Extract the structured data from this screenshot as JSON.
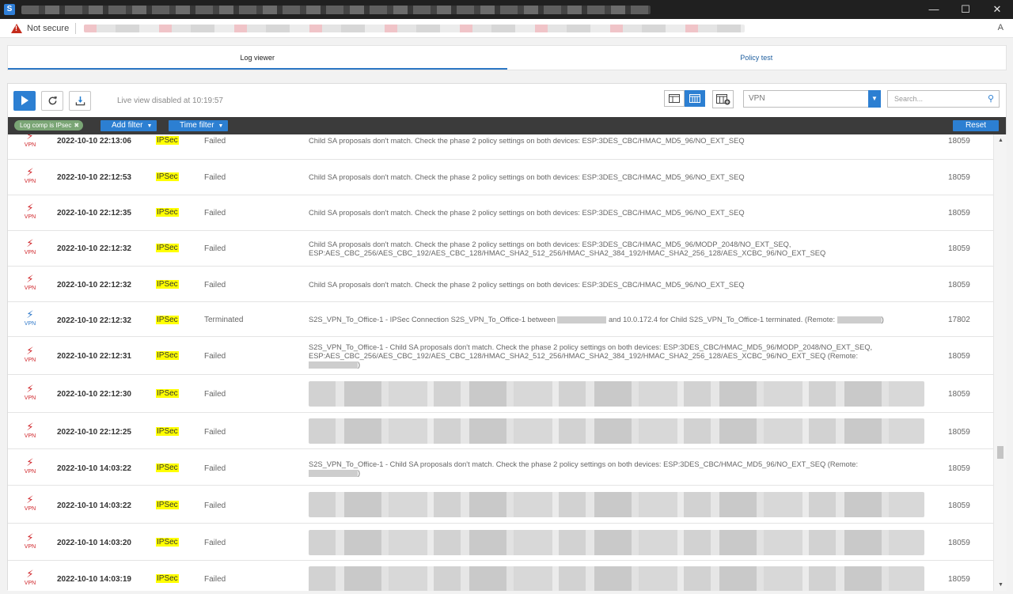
{
  "window": {
    "app_icon_letter": "S",
    "minimize": "—",
    "maximize": "☐",
    "close": "✕"
  },
  "address": {
    "security_label": "Not secure",
    "reader_icon": "A"
  },
  "tabs": [
    {
      "label": "Log viewer"
    },
    {
      "label": "Policy test"
    }
  ],
  "toolbar": {
    "live_status": "Live view disabled at 10:19:57",
    "play_icon": "play-icon",
    "refresh_icon": "refresh-icon",
    "download_icon": "download-icon",
    "log_type_value": "VPN",
    "search_placeholder": "Search..."
  },
  "filters": {
    "chip_label": "Log comp is IPsec",
    "chip_remove": "✖",
    "add_filter": "Add filter",
    "time_filter": "Time filter",
    "reset": "Reset"
  },
  "rows": [
    {
      "type_label": "VPN",
      "time": "2022-10-10 22:13:06",
      "component": "IPSec",
      "status": "Failed",
      "message": "Child SA proposals don't match. Check the phase 2 policy settings on both devices: ESP:3DES_CBC/HMAC_MD5_96/NO_EXT_SEQ",
      "id": "18059"
    },
    {
      "type_label": "VPN",
      "time": "2022-10-10 22:12:53",
      "component": "IPSec",
      "status": "Failed",
      "message": "Child SA proposals don't match. Check the phase 2 policy settings on both devices: ESP:3DES_CBC/HMAC_MD5_96/NO_EXT_SEQ",
      "id": "18059"
    },
    {
      "type_label": "VPN",
      "time": "2022-10-10 22:12:35",
      "component": "IPSec",
      "status": "Failed",
      "message": "Child SA proposals don't match. Check the phase 2 policy settings on both devices: ESP:3DES_CBC/HMAC_MD5_96/NO_EXT_SEQ",
      "id": "18059"
    },
    {
      "type_label": "VPN",
      "time": "2022-10-10 22:12:32",
      "component": "IPSec",
      "status": "Failed",
      "message_line1": "Child SA proposals don't match. Check the phase 2 policy settings on both devices: ESP:3DES_CBC/HMAC_MD5_96/MODP_2048/NO_EXT_SEQ,",
      "message_line2": "ESP:AES_CBC_256/AES_CBC_192/AES_CBC_128/HMAC_SHA2_512_256/HMAC_SHA2_384_192/HMAC_SHA2_256_128/AES_XCBC_96/NO_EXT_SEQ",
      "id": "18059"
    },
    {
      "type_label": "VPN",
      "time": "2022-10-10 22:12:32",
      "component": "IPSec",
      "status": "Failed",
      "message": "Child SA proposals don't match. Check the phase 2 policy settings on both devices: ESP:3DES_CBC/HMAC_MD5_96/NO_EXT_SEQ",
      "id": "18059"
    },
    {
      "type_label": "VPN",
      "time": "2022-10-10 22:12:32",
      "component": "IPSec",
      "status": "Terminated",
      "message_a": "S2S_VPN_To_Office-1 - IPSec Connection S2S_VPN_To_Office-1 between",
      "message_b": "and 10.0.172.4 for Child S2S_VPN_To_Office-1 terminated. (Remote:",
      "message_c": ")",
      "id": "17802"
    },
    {
      "type_label": "VPN",
      "time": "2022-10-10 22:12:31",
      "component": "IPSec",
      "status": "Failed",
      "message_line1": "S2S_VPN_To_Office-1 - Child SA proposals don't match. Check the phase 2 policy settings on both devices: ESP:3DES_CBC/HMAC_MD5_96/MODP_2048/NO_EXT_SEQ,",
      "message_line2": "ESP:AES_CBC_256/AES_CBC_192/AES_CBC_128/HMAC_SHA2_512_256/HMAC_SHA2_384_192/HMAC_SHA2_256_128/AES_XCBC_96/NO_EXT_SEQ (Remote:",
      "message_line3_end": ")",
      "id": "18059"
    },
    {
      "type_label": "VPN",
      "time": "2022-10-10 22:12:30",
      "component": "IPSec",
      "status": "Failed",
      "id": "18059"
    },
    {
      "type_label": "VPN",
      "time": "2022-10-10 22:12:25",
      "component": "IPSec",
      "status": "Failed",
      "id": "18059"
    },
    {
      "type_label": "VPN",
      "time": "2022-10-10 14:03:22",
      "component": "IPSec",
      "status": "Failed",
      "message": "S2S_VPN_To_Office-1 - Child SA proposals don't match. Check the phase 2 policy settings on both devices: ESP:3DES_CBC/HMAC_MD5_96/NO_EXT_SEQ (Remote:",
      "message_line2_end": ")",
      "id": "18059"
    },
    {
      "type_label": "VPN",
      "time": "2022-10-10 14:03:22",
      "component": "IPSec",
      "status": "Failed",
      "id": "18059"
    },
    {
      "type_label": "VPN",
      "time": "2022-10-10 14:03:20",
      "component": "IPSec",
      "status": "Failed",
      "id": "18059"
    },
    {
      "type_label": "VPN",
      "time": "2022-10-10 14:03:19",
      "component": "IPSec",
      "status": "Failed",
      "id": "18059"
    }
  ],
  "colors": {
    "accent": "#2c7fd2",
    "failed_icon": "#d0262b",
    "terminated_icon": "#2f78c9",
    "highlight": "#ffff00"
  }
}
